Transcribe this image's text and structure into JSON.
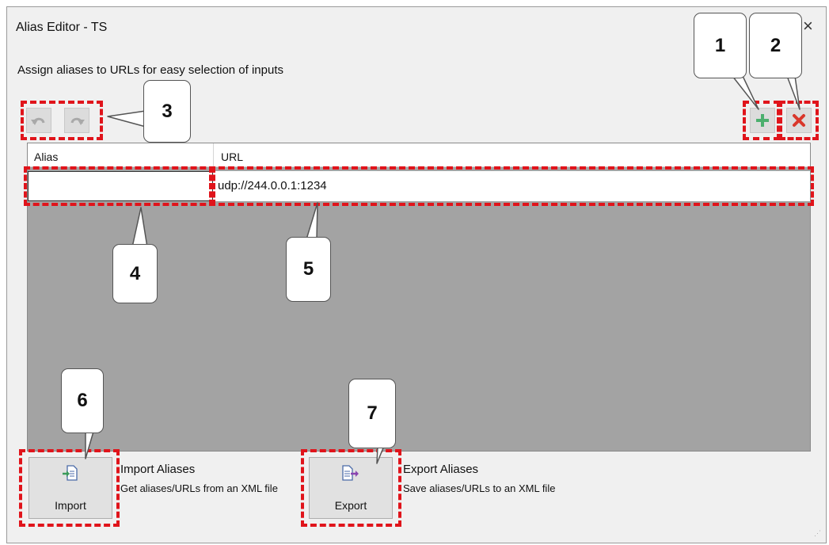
{
  "window": {
    "title": "Alias Editor - TS",
    "close_glyph": "×"
  },
  "subtitle": "Assign aliases to URLs for easy selection of inputs",
  "toolbar": {
    "undo_icon": "undo-icon",
    "redo_icon": "redo-icon",
    "add_icon": "plus-icon",
    "delete_icon": "x-icon",
    "add_color": "#4caf6e",
    "delete_color": "#d9372b"
  },
  "table": {
    "columns": [
      "Alias",
      "URL"
    ],
    "rows": [
      {
        "alias": "",
        "url": "udp://244.0.0.1:1234"
      }
    ]
  },
  "import": {
    "button_label": "Import",
    "title": "Import Aliases",
    "description": "Get aliases/URLs from an XML file"
  },
  "export": {
    "button_label": "Export",
    "title": "Export Aliases",
    "description": "Save aliases/URLs to an XML file"
  },
  "callouts": [
    "1",
    "2",
    "3",
    "4",
    "5",
    "6",
    "7"
  ],
  "highlight_color": "#e0141b"
}
